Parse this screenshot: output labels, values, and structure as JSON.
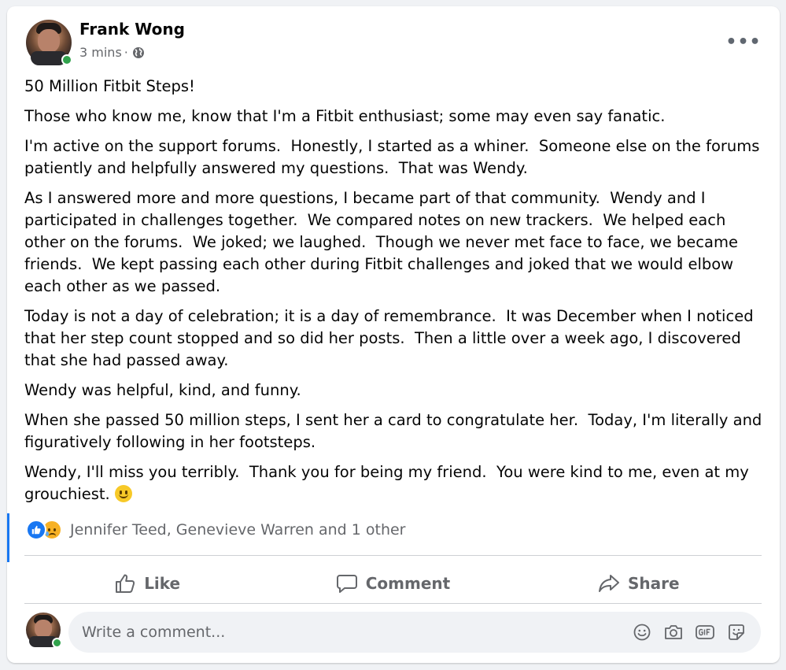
{
  "post": {
    "author": "Frank Wong",
    "time": "3 mins",
    "separator": "·",
    "privacy_icon": "globe-icon",
    "more_label": "•••",
    "paragraphs": [
      "50 Million Fitbit Steps!",
      "Those who know me, know that I'm a Fitbit enthusiast; some may even say fanatic.",
      "I'm active on the support forums.  Honestly, I started as a whiner.  Someone else on the forums patiently and helpfully answered my questions.  That was Wendy.",
      "As I answered more and more questions, I became part of that community.  Wendy and I participated in challenges together.  We compared notes on new trackers.  We helped each other on the forums.  We joked; we laughed.  Though we never met face to face, we became friends.  We kept passing each other during Fitbit challenges and joked that we would elbow each other as we passed.",
      "Today is not a day of celebration; it is a day of remembrance.  It was December when I noticed that her step count stopped and so did her posts.  Then a little over a week ago, I discovered that she had passed away.",
      "Wendy was helpful, kind, and funny.",
      "When she passed 50 million steps, I sent her a card to congratulate her.  Today, I'm literally and figuratively following in her footsteps.",
      "Wendy, I'll miss you terribly.  Thank you for being my friend.  You were kind to me, even at my grouchiest."
    ],
    "reactions": {
      "icons": [
        "like-reaction-icon",
        "sad-reaction-icon"
      ],
      "names": "Jennifer Teed, Genevieve Warren and 1 other"
    }
  },
  "actions": {
    "like": "Like",
    "comment": "Comment",
    "share": "Share"
  },
  "comment_box": {
    "placeholder": "Write a comment...",
    "icons": [
      "emoji-icon",
      "camera-icon",
      "gif-icon",
      "sticker-icon"
    ]
  },
  "colors": {
    "accent": "#1877f2",
    "online": "#31a24c",
    "secondary_text": "#65676b"
  }
}
